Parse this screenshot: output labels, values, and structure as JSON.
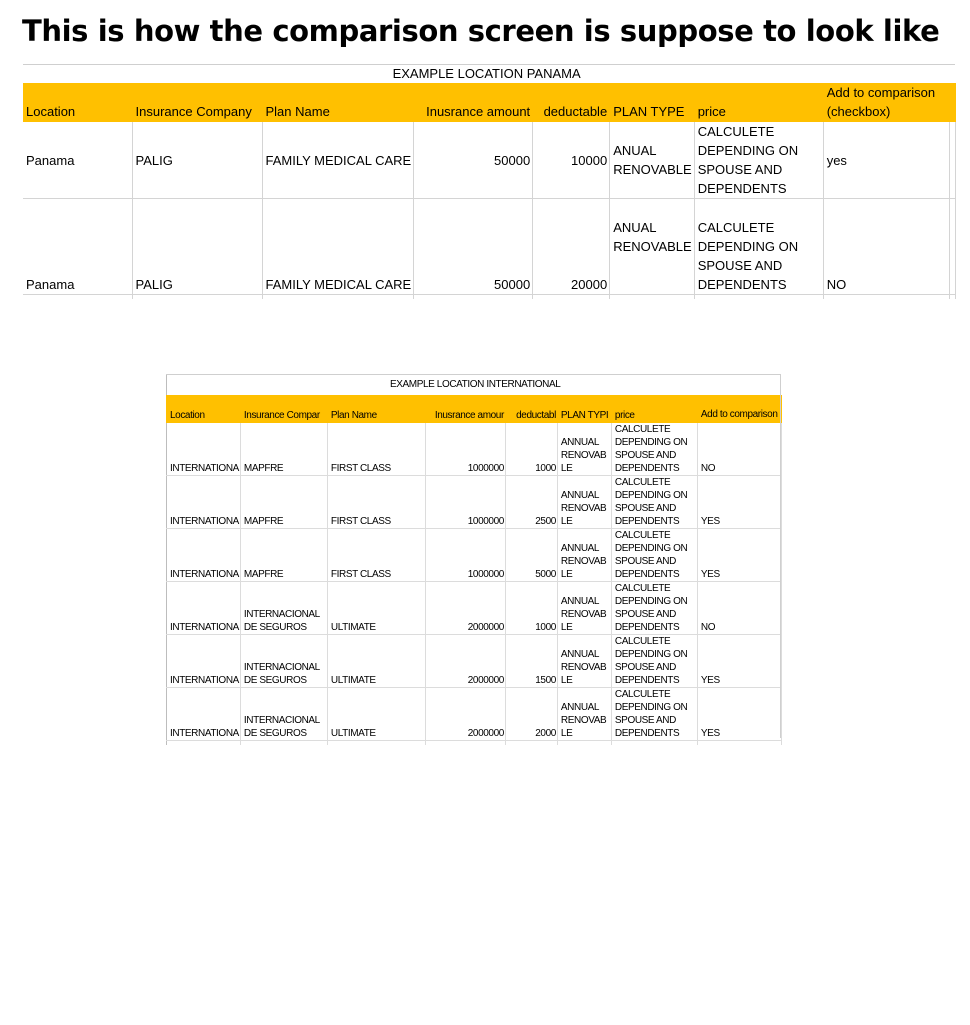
{
  "heading": "This is how the comparison screen is suppose to look like",
  "table_panama": {
    "title": "EXAMPLE LOCATION PANAMA",
    "headers": {
      "location": "Location",
      "company": "Insurance Company",
      "plan": "Plan Name",
      "amount": "Inusrance amount",
      "deductable": "deductable",
      "plan_type": "PLAN TYPE",
      "price": "price",
      "add": "Add to comparison (checkbox)"
    },
    "rows": [
      {
        "location": "Panama",
        "company": "PALIG",
        "plan": "FAMILY MEDICAL CARE",
        "amount": "50000",
        "deductable": "10000",
        "plan_type": "ANUAL RENOVABLE",
        "price": "CALCULETE DEPENDING ON SPOUSE AND DEPENDENTS",
        "add": "yes"
      },
      {
        "location": "Panama",
        "company": "PALIG",
        "plan": "FAMILY MEDICAL CARE",
        "amount": "50000",
        "deductable": "20000",
        "plan_type": "ANUAL RENOVABLE",
        "price": "CALCULETE DEPENDING ON SPOUSE AND DEPENDENTS",
        "add": "NO"
      }
    ]
  },
  "table_international": {
    "title": "EXAMPLE LOCATION INTERNATIONAL",
    "headers": {
      "location": "Location",
      "company": "Insurance Compar",
      "plan": "Plan Name",
      "amount": "Inusrance amour",
      "deductable": "deductabl",
      "plan_type": "PLAN TYPI",
      "price": "price",
      "add": "Add to comparison"
    },
    "rows": [
      {
        "location": "INTERNATIONA",
        "company": "MAPFRE",
        "plan": "FIRST CLASS",
        "amount": "1000000",
        "deductable": "1000",
        "plan_type": "ANNUAL RENOVAB LE",
        "price": "CALCULETE DEPENDING ON SPOUSE AND DEPENDENTS",
        "add": "NO"
      },
      {
        "location": "INTERNATIONA",
        "company": "MAPFRE",
        "plan": "FIRST CLASS",
        "amount": "1000000",
        "deductable": "2500",
        "plan_type": "ANNUAL RENOVAB LE",
        "price": "CALCULETE DEPENDING ON SPOUSE AND DEPENDENTS",
        "add": "YES"
      },
      {
        "location": "INTERNATIONA",
        "company": "MAPFRE",
        "plan": "FIRST CLASS",
        "amount": "1000000",
        "deductable": "5000",
        "plan_type": "ANNUAL RENOVAB LE",
        "price": "CALCULETE DEPENDING ON SPOUSE AND DEPENDENTS",
        "add": "YES"
      },
      {
        "location": "INTERNATIONA",
        "company": "INTERNACIONAL DE SEGUROS",
        "plan": "ULTIMATE",
        "amount": "2000000",
        "deductable": "1000",
        "plan_type": "ANNUAL RENOVAB LE",
        "price": "CALCULETE DEPENDING ON SPOUSE AND DEPENDENTS",
        "add": "NO"
      },
      {
        "location": "INTERNATIONA",
        "company": "INTERNACIONAL DE SEGUROS",
        "plan": "ULTIMATE",
        "amount": "2000000",
        "deductable": "1500",
        "plan_type": "ANNUAL RENOVAB LE",
        "price": "CALCULETE DEPENDING ON SPOUSE AND DEPENDENTS",
        "add": "YES"
      },
      {
        "location": "INTERNATIONA",
        "company": "INTERNACIONAL DE SEGUROS",
        "plan": "ULTIMATE",
        "amount": "2000000",
        "deductable": "2000",
        "plan_type": "ANNUAL RENOVAB LE",
        "price": "CALCULETE DEPENDING ON SPOUSE AND DEPENDENTS",
        "add": "YES"
      }
    ]
  }
}
